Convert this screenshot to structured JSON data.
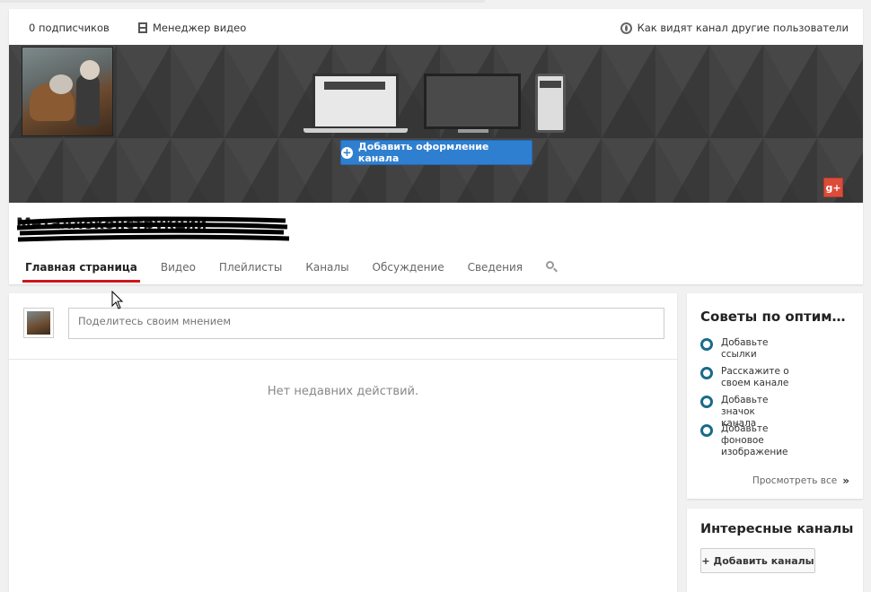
{
  "topbar": {
    "subscribers": "0 подписчиков",
    "video_manager": "Менеджер видео",
    "view_as": "Как видят канал другие пользователи"
  },
  "banner": {
    "add_design_button": "Добавить оформление канала",
    "gplus_label": "g+"
  },
  "channel": {
    "name": "Металлоконструкции"
  },
  "tabs": [
    {
      "label": "Главная страница",
      "active": true
    },
    {
      "label": "Видео"
    },
    {
      "label": "Плейлисты"
    },
    {
      "label": "Каналы"
    },
    {
      "label": "Обсуждение"
    },
    {
      "label": "Сведения"
    }
  ],
  "feed": {
    "placeholder": "Поделитесь своим мнением",
    "empty_text": "Нет недавних действий."
  },
  "tips": {
    "title": "Советы по оптим…",
    "items": [
      "Добавьте ссылки",
      "Расскажите о своем канале",
      "Добавьте значок канала",
      "Добавьте фоновое изображение"
    ],
    "see_all": "Просмотреть все",
    "see_all_arrow": "»"
  },
  "interesting": {
    "title": "Интересные каналы",
    "add_button": "+ Добавить каналы"
  },
  "colors": {
    "accent_red": "#cc181e",
    "button_blue": "#2f7fd0",
    "tip_circle": "#1a6b8c",
    "banner_bg": "#3d3d3d"
  },
  "icons": [
    "video-manager-icon",
    "globe-icon",
    "plus-circle-icon",
    "gplus-icon",
    "search-icon",
    "chevron-right-icon",
    "mouse-cursor-icon"
  ]
}
